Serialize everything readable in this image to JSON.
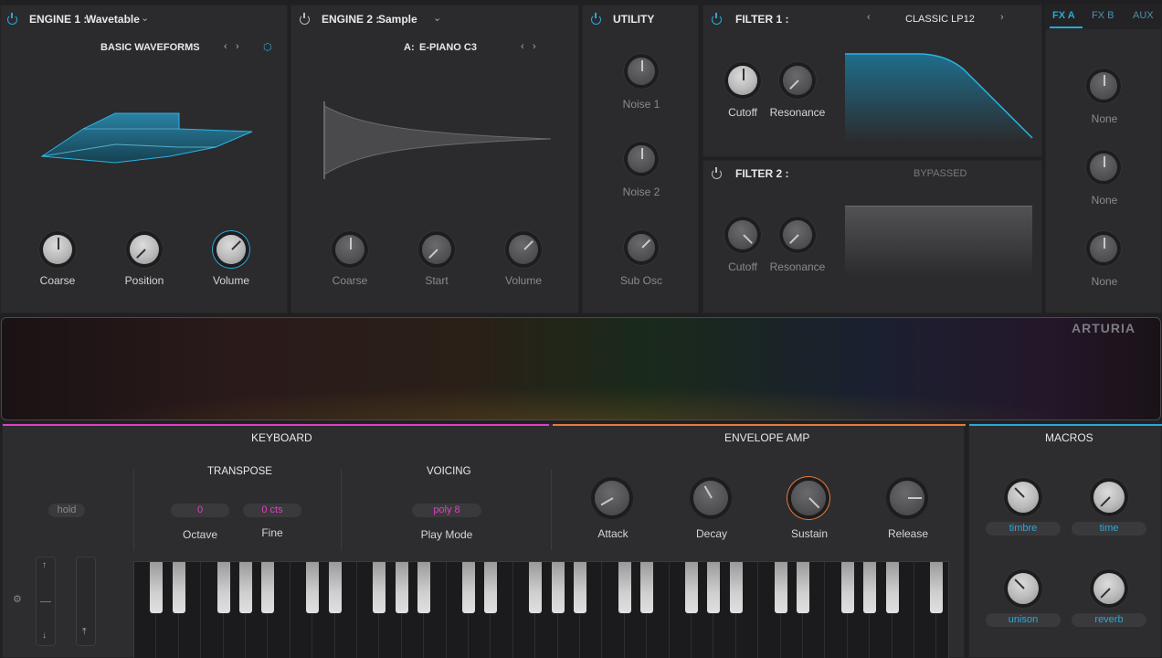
{
  "engine1": {
    "title": "ENGINE 1 :",
    "type": "Wavetable",
    "preset": "BASIC WAVEFORMS",
    "knobs": [
      "Coarse",
      "Position",
      "Volume"
    ]
  },
  "engine2": {
    "title": "ENGINE 2 :",
    "type": "Sample",
    "sample_prefix": "A:",
    "sample_name": "E-PIANO C3",
    "knobs": [
      "Coarse",
      "Start",
      "Volume"
    ]
  },
  "utility": {
    "title": "UTILITY",
    "knobs": [
      "Noise 1",
      "Noise 2",
      "Sub Osc"
    ]
  },
  "filter1": {
    "title": "FILTER 1 :",
    "type": "CLASSIC LP12",
    "knobs": [
      "Cutoff",
      "Resonance"
    ]
  },
  "filter2": {
    "title": "FILTER 2 :",
    "status": "BYPASSED",
    "knobs": [
      "Cutoff",
      "Resonance"
    ]
  },
  "fx": {
    "tabs": [
      "FX A",
      "FX B",
      "AUX"
    ],
    "slots": [
      "None",
      "None",
      "None"
    ]
  },
  "brand": "ARTURIA",
  "keyboard": {
    "title": "KEYBOARD",
    "hold": "hold",
    "transpose": "TRANSPOSE",
    "octave_value": "0",
    "octave_label": "Octave",
    "fine_value": "0 cts",
    "fine_label": "Fine",
    "voicing": "VOICING",
    "playmode_value": "poly 8",
    "playmode_label": "Play Mode"
  },
  "envelope": {
    "title": "ENVELOPE AMP",
    "knobs": [
      "Attack",
      "Decay",
      "Sustain",
      "Release"
    ]
  },
  "macros": {
    "title": "MACROS",
    "items": [
      "timbre",
      "time",
      "unison",
      "reverb"
    ]
  },
  "colors": {
    "accent_blue": "#2aa8d8",
    "accent_pink": "#e040c0",
    "accent_orange": "#e8793a"
  }
}
